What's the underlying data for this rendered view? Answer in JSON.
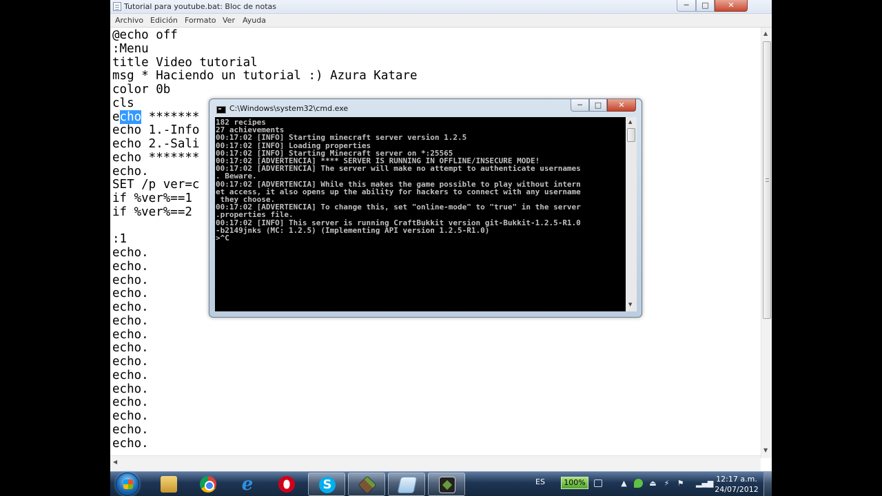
{
  "notepad": {
    "title": "Tutorial para youtube.bat: Bloc de notas",
    "controls": {
      "minimize": "─",
      "maximize": "□",
      "close": "✕"
    },
    "menu": [
      "Archivo",
      "Edición",
      "Formato",
      "Ver",
      "Ayuda"
    ],
    "lines": [
      "@echo off",
      ":Menu",
      "title Video tutorial",
      "msg * Haciendo un tutorial :) Azura Katare",
      "color 0b",
      "cls",
      "",
      "echo 1.-Info",
      "echo 2.-Sali",
      "echo *******",
      "echo.",
      "SET /p ver=c",
      "if %ver%==1",
      "if %ver%==2",
      "",
      ":1",
      "echo.",
      "echo.",
      "echo.",
      "echo.",
      "echo.",
      "echo.",
      "echo.",
      "echo.",
      "echo.",
      "echo.",
      "echo.",
      "echo.",
      "echo.",
      "echo.",
      "echo."
    ],
    "line7": {
      "pre": "e",
      "selected": "cho",
      "post": " *******"
    }
  },
  "cmd": {
    "title": "C:\\Windows\\system32\\cmd.exe",
    "controls": {
      "minimize": "─",
      "maximize": "□",
      "close": "✕"
    },
    "lines": [
      "182 recipes",
      "27 achievements",
      "00:17:02 [INFO] Starting minecraft server version 1.2.5",
      "00:17:02 [INFO] Loading properties",
      "00:17:02 [INFO] Starting Minecraft server on *:25565",
      "00:17:02 [ADVERTENCIA] **** SERVER IS RUNNING IN OFFLINE/INSECURE MODE!",
      "00:17:02 [ADVERTENCIA] The server will make no attempt to authenticate usernames",
      ". Beware.",
      "00:17:02 [ADVERTENCIA] While this makes the game possible to play without intern",
      "et access, it also opens up the ability for hackers to connect with any username",
      " they choose.",
      "00:17:02 [ADVERTENCIA] To change this, set \"online-mode\" to \"true\" in the server",
      ".properties file.",
      "00:17:02 [INFO] This server is running CraftBukkit version git-Bukkit-1.2.5-R1.0",
      "-b2149jnks (MC: 1.2.5) (Implementing API version 1.2.5-R1.0)",
      ">^C"
    ]
  },
  "taskbar": {
    "apps": [
      {
        "name": "explorer",
        "active": false
      },
      {
        "name": "chrome",
        "active": false
      },
      {
        "name": "ie",
        "label": "e",
        "active": false
      },
      {
        "name": "opera",
        "active": false
      },
      {
        "name": "skype",
        "label": "S",
        "active": true
      },
      {
        "name": "minecraft",
        "active": true
      },
      {
        "name": "notepad",
        "active": true
      },
      {
        "name": "cmd",
        "active": true
      }
    ],
    "tray": {
      "language": "ES",
      "battery": "100%",
      "time": "12:17 a.m.",
      "date": "24/07/2012"
    }
  },
  "colors": {
    "selection": "#3399ff",
    "console_bg": "#000000",
    "console_text": "#c0c0c0",
    "close_button": "#c84a33"
  },
  "icons": [
    "start-orb-icon",
    "notepad-doc-icon",
    "cmd-icon",
    "explorer-folder-icon",
    "chrome-icon",
    "ie-icon",
    "opera-icon",
    "skype-icon",
    "minecraft-icon",
    "notepad-app-icon",
    "cmd-minecraft-icon"
  ]
}
